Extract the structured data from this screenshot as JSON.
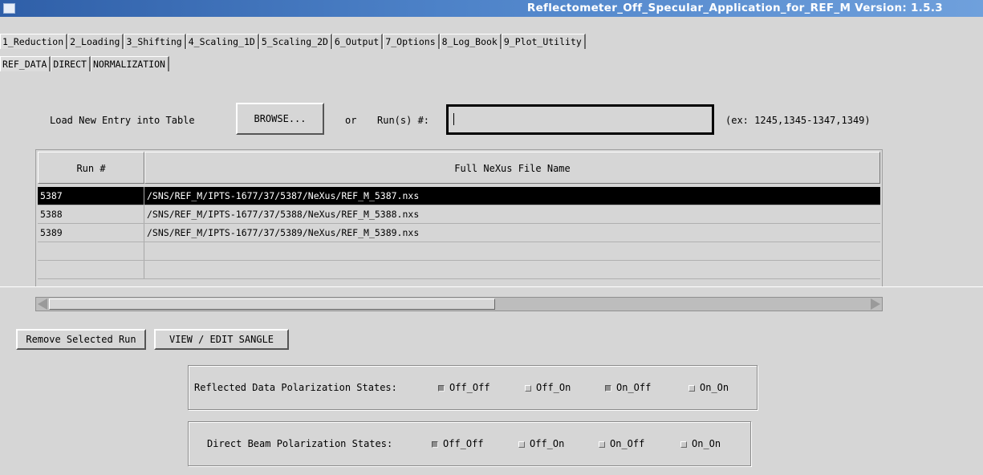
{
  "window": {
    "title": "Reflectometer_Off_Specular_Application_for_REF_M Version: 1.5.3"
  },
  "main_tabs": [
    {
      "label": "1_Reduction"
    },
    {
      "label": "2_Loading"
    },
    {
      "label": "3_Shifting"
    },
    {
      "label": "4_Scaling_1D"
    },
    {
      "label": "5_Scaling_2D"
    },
    {
      "label": "6_Output"
    },
    {
      "label": "7_Options"
    },
    {
      "label": "8_Log_Book"
    },
    {
      "label": "9_Plot_Utility"
    }
  ],
  "sub_tabs": [
    {
      "label": "REF_DATA"
    },
    {
      "label": "DIRECT"
    },
    {
      "label": "NORMALIZATION"
    }
  ],
  "load": {
    "label": "Load New Entry into Table",
    "browse_label": "BROWSE...",
    "or_label": "or",
    "runs_label": "Run(s) #:",
    "runs_value": "",
    "example": "(ex: 1245,1345-1347,1349)"
  },
  "table": {
    "headers": [
      "Run #",
      "Full NeXus File Name"
    ],
    "rows": [
      {
        "run": "5387",
        "file": "/SNS/REF_M/IPTS-1677/37/5387/NeXus/REF_M_5387.nxs",
        "selected": true
      },
      {
        "run": "5388",
        "file": "/SNS/REF_M/IPTS-1677/37/5388/NeXus/REF_M_5388.nxs",
        "selected": false
      },
      {
        "run": "5389",
        "file": "/SNS/REF_M/IPTS-1677/37/5389/NeXus/REF_M_5389.nxs",
        "selected": false
      },
      {
        "run": "",
        "file": "",
        "selected": false
      },
      {
        "run": "",
        "file": "",
        "selected": false
      }
    ]
  },
  "actions": {
    "remove_label": "Remove Selected Run",
    "sangle_label": "VIEW / EDIT SANGLE"
  },
  "reflected": {
    "label": "Reflected Data Polarization States:",
    "states": [
      {
        "label": "Off_Off",
        "checked": true
      },
      {
        "label": "Off_On",
        "checked": false
      },
      {
        "label": "On_Off",
        "checked": true
      },
      {
        "label": "On_On",
        "checked": false
      }
    ]
  },
  "direct": {
    "label": "Direct Beam Polarization States:",
    "states": [
      {
        "label": "Off_Off",
        "checked": true
      },
      {
        "label": "Off_On",
        "checked": false
      },
      {
        "label": "On_Off",
        "checked": false
      },
      {
        "label": "On_On",
        "checked": false
      }
    ]
  },
  "colors": {
    "background": "#d6d6d6",
    "titlebar": "#2f5fa8",
    "selection": "#000000"
  }
}
